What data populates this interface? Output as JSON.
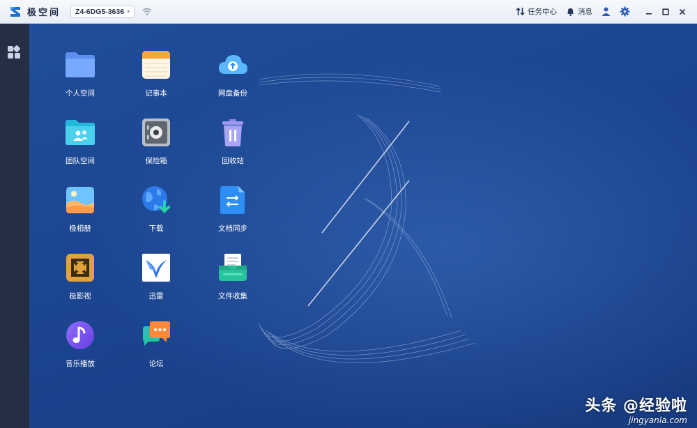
{
  "titlebar": {
    "app_name": "极空间",
    "device_name": "Z4-6DG5-3636",
    "tasks_label": "任务中心",
    "messages_label": "消息"
  },
  "icons": {
    "logo": "zspace-logo-icon",
    "wifi": "wifi-icon",
    "tasks": "transfer-arrows-icon",
    "messages": "bell-icon",
    "user": "user-icon",
    "settings": "gear-icon",
    "minimize": "minimize-icon",
    "maximize": "maximize-icon",
    "close": "close-icon",
    "sidebar_apps": "apps-grid-icon"
  },
  "apps": [
    {
      "label": "个人空间",
      "icon": "folder-icon"
    },
    {
      "label": "记事本",
      "icon": "notepad-icon"
    },
    {
      "label": "网盘备份",
      "icon": "cloud-upload-icon"
    },
    {
      "label": "团队空间",
      "icon": "team-folder-icon"
    },
    {
      "label": "保险箱",
      "icon": "safe-icon"
    },
    {
      "label": "回收站",
      "icon": "trash-icon"
    },
    {
      "label": "极相册",
      "icon": "photo-album-icon"
    },
    {
      "label": "下载",
      "icon": "globe-download-icon"
    },
    {
      "label": "文档同步",
      "icon": "document-sync-icon"
    },
    {
      "label": "极影视",
      "icon": "film-icon"
    },
    {
      "label": "迅雷",
      "icon": "thunder-bird-icon"
    },
    {
      "label": "文件收集",
      "icon": "file-collect-icon"
    },
    {
      "label": "音乐播放",
      "icon": "music-note-icon"
    },
    {
      "label": "论坛",
      "icon": "chat-bubbles-icon"
    }
  ],
  "watermark": {
    "main": "头条 @经验啦",
    "sub": "jingyanla.com"
  },
  "colors": {
    "desktop_bg": "#1c4590",
    "sidebar_bg": "#242e44",
    "titlebar_bg": "#eef2f8",
    "accent": "#2a6fd6"
  }
}
